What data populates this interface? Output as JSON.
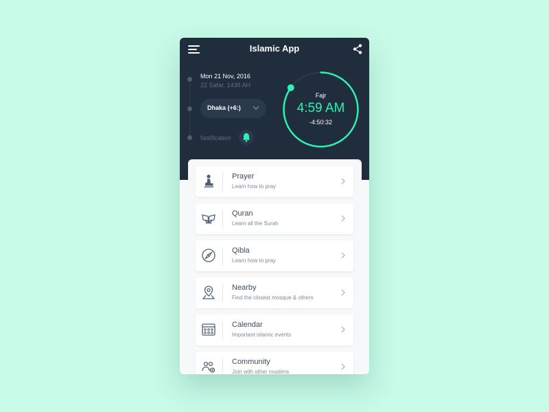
{
  "app": {
    "title": "Islamic App"
  },
  "header": {
    "date": "Mon 21 Nov, 2016",
    "hijri_date": "22 Safar, 1438 AH",
    "location": "Dhaka (+6:)",
    "notification_label": "Notification",
    "prayer": {
      "name": "Fajr",
      "time": "4:59 AM",
      "countdown": "-4:50:32",
      "progress": 0.85
    }
  },
  "menu_items": [
    {
      "title": "Prayer",
      "subtitle": "Learn how to pray",
      "icon": "prayer-icon"
    },
    {
      "title": "Quran",
      "subtitle": "Learn all the Surah",
      "icon": "quran-icon"
    },
    {
      "title": "Qibla",
      "subtitle": "Learn how to pray",
      "icon": "compass-icon"
    },
    {
      "title": "Nearby",
      "subtitle": "Find the closest mosque & others",
      "icon": "location-pin-icon"
    },
    {
      "title": "Calendar",
      "subtitle": "Important islamic events",
      "icon": "calendar-icon"
    },
    {
      "title": "Community",
      "subtitle": "Join with other muslims",
      "icon": "community-icon"
    }
  ],
  "colors": {
    "background": "#c8fbe8",
    "header": "#1f2d3d",
    "accent": "#2ff0b5",
    "text_dark": "#3d4c5e",
    "text_muted": "#7d8a99"
  }
}
